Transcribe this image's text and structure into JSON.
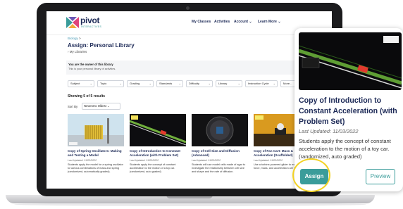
{
  "brand": {
    "name": "pivot",
    "sub": "INTERACTIVES",
    "accent": "#3a9c9a",
    "navy": "#1d2a57"
  },
  "nav": {
    "my_classes": "My Classes",
    "activities": "Activities",
    "account": "Account",
    "learn_more": "Learn More",
    "chevron": "chevron-down-icon"
  },
  "breadcrumb": {
    "label": "Biology",
    "separator": ">"
  },
  "page": {
    "title": "Assign: Personal Library",
    "libraries_link": "My Libraries"
  },
  "owner": {
    "title": "You are the owner of this library",
    "subtitle": "This is your personal library of activities."
  },
  "filters": [
    "Subject",
    "Topic",
    "Grading",
    "Standards",
    "Difficulty",
    "Library",
    "Instruction Cycle",
    "More..."
  ],
  "results_text": "Showing 5 of 5 results",
  "sort": {
    "label": "Sort By",
    "value": "Newest to Oldest"
  },
  "cards": [
    {
      "title": "Copy of Spring Oscillators: Making and Testing a Model",
      "date": "Last Updated: 11/03/2022",
      "desc": "Students apply the model for a spring oscillator to various combinations of mass and spring (randomized, automatically graded)."
    },
    {
      "title": "Copy of Introduction to Constant Acceleration (with Problem Set)",
      "date": "Last Updated: 11/03/2022",
      "desc": "Students apply the concept of constant acceleration to the motion of a toy car. (randomized, auto graded)"
    },
    {
      "title": "Copy of Cell Size and Diffusion (Advanced)",
      "date": "Last Updated: 11/03/2022",
      "desc": "Students will use model cells made of agar to investigate the relationship between cell size and shape and the rate of diffusion."
    },
    {
      "title": "Copy of Fan Cart: Mass & Acceleration (Scaffolded)",
      "date": "Last Updated: 11/03/2022",
      "desc": "Use a turbine-powered glider to explore how force, mass, and acceleration are related."
    }
  ],
  "popup": {
    "title": "Copy of Introduction to Constant Acceleration (with Problem Set)",
    "date": "Last Updated: 11/03/2022",
    "desc": "Students apply the concept of constant acceleration to the motion of a toy car. (randomized, auto graded)",
    "assign_label": "Assign",
    "preview_label": "Preview",
    "highlight_color": "#f3d224"
  }
}
